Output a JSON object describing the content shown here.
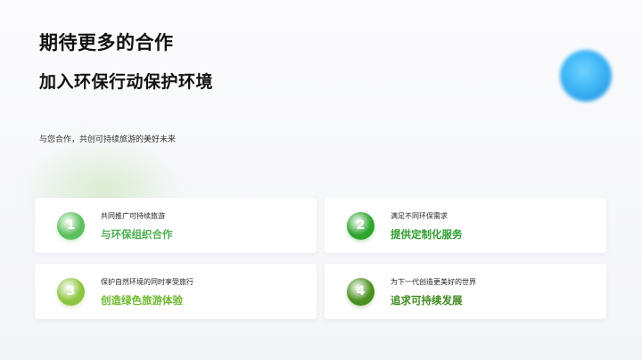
{
  "page": {
    "title": "期待更多的合作",
    "subtitle": "加入环保行动保护环境",
    "intro": "与您合作，共创可持续旅游的美好未来"
  },
  "cards": [
    {
      "number": "1",
      "description": "共同推广可持续旅游",
      "heading": "与环保组织合作",
      "accent_color": "#4caf50",
      "badge_color": "#5cbf5c"
    },
    {
      "number": "2",
      "description": "满足不同环保需求",
      "heading": "提供定制化服务",
      "accent_color": "#2e9d2e",
      "badge_color": "#2ea32e"
    },
    {
      "number": "3",
      "description": "保护自然环境的同时享受旅行",
      "heading": "创造绿色旅游体验",
      "accent_color": "#6ab82a",
      "badge_color": "#8cc63f"
    },
    {
      "number": "4",
      "description": "为下一代创造更美好的世界",
      "heading": "追求可持续发展",
      "accent_color": "#3f8a1e",
      "badge_color": "#4a8f1f"
    }
  ]
}
